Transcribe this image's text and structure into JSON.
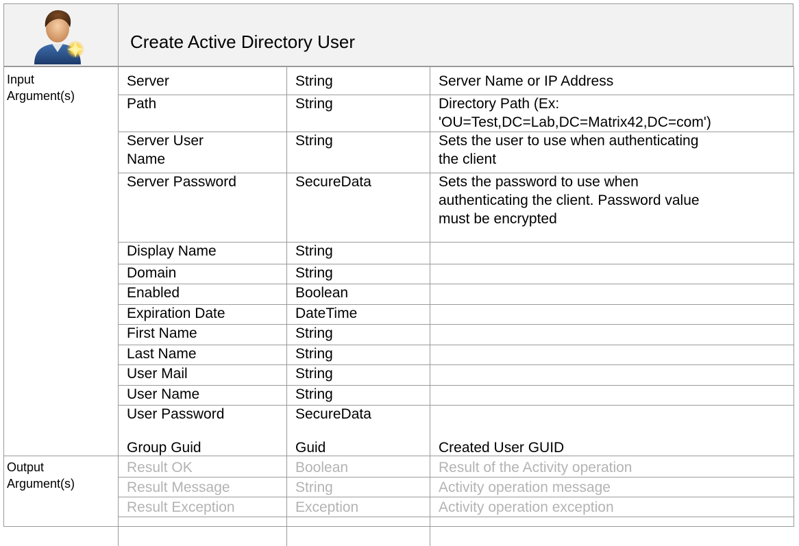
{
  "header": {
    "title": "Create Active Directory User",
    "icon": "user-star-icon"
  },
  "sections": {
    "input": {
      "line1": "Input",
      "line2": "Argument(s)"
    },
    "output": {
      "line1": "Output",
      "line2": "Argument(s)"
    }
  },
  "inputs": [
    {
      "name": [
        "Server"
      ],
      "type": "String",
      "desc": [
        "Server Name or IP Address"
      ]
    },
    {
      "name": [
        "Path"
      ],
      "type": "String",
      "desc": [
        "Directory Path (Ex:",
        "'OU=Test,DC=Lab,DC=Matrix42,DC=com')"
      ]
    },
    {
      "name": [
        "Server User",
        "Name"
      ],
      "type": "String",
      "desc": [
        "Sets the user to use when authenticating",
        "the client"
      ]
    },
    {
      "name": [
        "Server Password"
      ],
      "type": "SecureData",
      "desc": [
        "Sets the password to use when",
        "authenticating the client. Password value",
        "must be encrypted"
      ]
    },
    {
      "name": [
        "Display Name"
      ],
      "type": "String",
      "desc": []
    },
    {
      "name": [
        "Domain"
      ],
      "type": "String",
      "desc": []
    },
    {
      "name": [
        "Enabled"
      ],
      "type": "Boolean",
      "desc": []
    },
    {
      "name": [
        "Expiration Date"
      ],
      "type": "DateTime",
      "desc": []
    },
    {
      "name": [
        "First Name"
      ],
      "type": "String",
      "desc": []
    },
    {
      "name": [
        "Last Name"
      ],
      "type": "String",
      "desc": []
    },
    {
      "name": [
        "User Mail"
      ],
      "type": "String",
      "desc": []
    },
    {
      "name": [
        "User Name"
      ],
      "type": "String",
      "desc": []
    },
    {
      "name": [
        "User Password"
      ],
      "type": "SecureData",
      "desc": []
    }
  ],
  "outputs": [
    {
      "name": [
        "Group Guid"
      ],
      "type": "Guid",
      "desc": [
        "Created User GUID"
      ],
      "dim": false
    },
    {
      "name": [
        "Result OK"
      ],
      "type": "Boolean",
      "desc": [
        "Result of the Activity operation"
      ],
      "dim": true
    },
    {
      "name": [
        "Result Message"
      ],
      "type": "String",
      "desc": [
        "Activity operation message"
      ],
      "dim": true
    },
    {
      "name": [
        "Result Exception"
      ],
      "type": "Exception",
      "desc": [
        "Activity operation exception"
      ],
      "dim": true
    }
  ],
  "colors": {
    "border": "#9a9a9a",
    "header_bg": "#f2f2f2",
    "dim_text": "#b3b3b3"
  }
}
